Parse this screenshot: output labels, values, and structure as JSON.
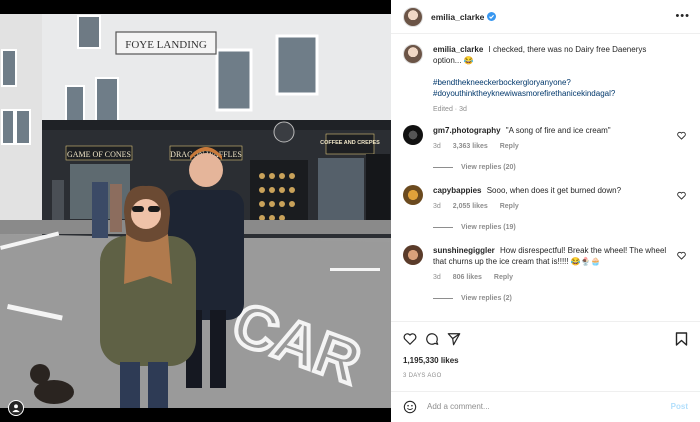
{
  "colors": {
    "link": "#00376b",
    "verified": "#3897f0",
    "muted": "#8e8e8e",
    "post_disabled": "#b2dffc"
  },
  "photo": {
    "sign_text": "FOYE LANDING",
    "shop_signs": [
      "GAME OF CONES",
      "DRAGON WAFFLES",
      "COFFEE AND CREPES"
    ],
    "road_text": "CAR"
  },
  "header": {
    "username": "emilia_clarke",
    "verified_icon": "verified-badge-icon",
    "more_icon": "more-options-icon"
  },
  "caption": {
    "username": "emilia_clarke",
    "text": "I checked, there was no Dairy free Daenerys option... 😂",
    "hashtags": [
      "#bendthekneeckerbockergloryanyone?",
      "#doyouthinktheyknewiwasmorefirethanicekindagal?"
    ],
    "edited": "Edited · 3d"
  },
  "comments": [
    {
      "username": "gm7.photography",
      "text": "\"A song of fire and ice cream\"",
      "age": "3d",
      "likes": "3,363 likes",
      "reply": "Reply",
      "view_replies": "View replies (20)"
    },
    {
      "username": "capybappies",
      "text": "Sooo, when does it get burned down?",
      "age": "3d",
      "likes": "2,055 likes",
      "reply": "Reply",
      "view_replies": "View replies (19)"
    },
    {
      "username": "sunshinegiggler",
      "text": "How disrespectful! Break the wheel! The wheel that churns up the ice cream that is!!!!! 😂🍨🧁",
      "age": "3d",
      "likes": "806 likes",
      "reply": "Reply",
      "view_replies": "View replies (2)"
    }
  ],
  "actions": {
    "likes": "1,195,330 likes",
    "time": "3 DAYS AGO",
    "add_comment_placeholder": "Add a comment...",
    "post_label": "Post"
  }
}
